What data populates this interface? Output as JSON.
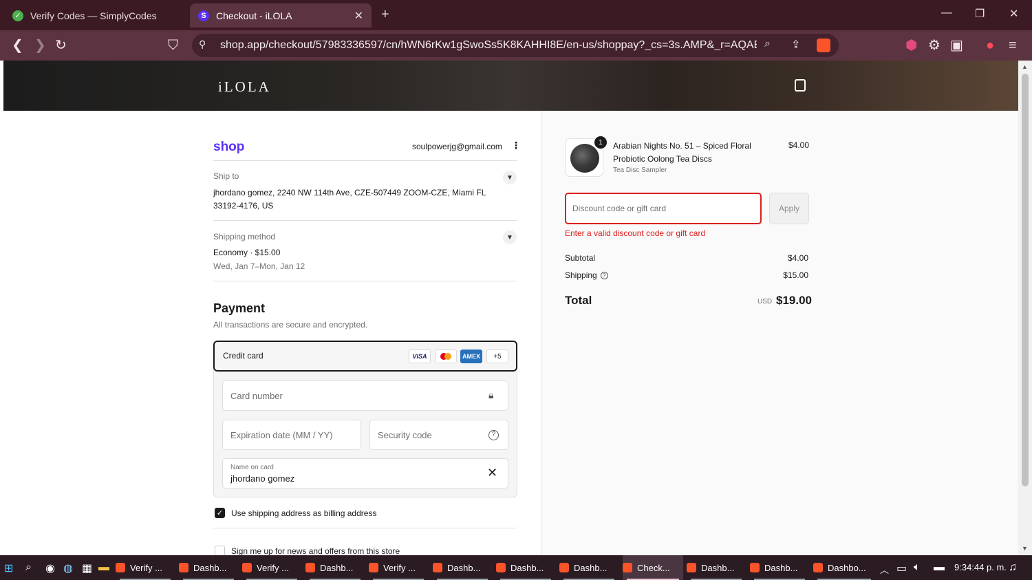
{
  "browser": {
    "tabs": [
      {
        "title": "Verify Codes — SimplyCodes",
        "active": false
      },
      {
        "title": "Checkout - iLOLA",
        "active": true
      }
    ],
    "url": "shop.app/checkout/57983336597/cn/hWN6rKw1gSwoSs5K8KAHHI8E/en-us/shoppay?_cs=3s.AMP&_r=AQABnr_..."
  },
  "store": {
    "logo": "iLOLA"
  },
  "checkout": {
    "shop_logo": "shop",
    "email": "soulpowerjg@gmail.com",
    "ship_to": {
      "label": "Ship to",
      "address_line1": "jhordano gomez, 2240 NW 114th Ave, CZE-507449 ZOOM-CZE, Miami FL",
      "address_line2": "33192-4176, US"
    },
    "shipping_method": {
      "label": "Shipping method",
      "name": "Economy · $15.00",
      "dates": "Wed, Jan 7–Mon, Jan 12"
    },
    "payment": {
      "title": "Payment",
      "subtitle": "All transactions are secure and encrypted.",
      "method_label": "Credit card",
      "card_brands": [
        "VISA",
        "",
        "AMEX",
        "+5"
      ],
      "card_number_placeholder": "Card number",
      "expiration_placeholder": "Expiration date (MM / YY)",
      "security_placeholder": "Security code",
      "name_label": "Name on card",
      "name_value": "jhordano gomez"
    },
    "billing_checkbox": {
      "label": "Use shipping address as billing address",
      "checked": true
    },
    "newsletter_checkbox": {
      "label": "Sign me up for news and offers from this store",
      "checked": false
    }
  },
  "order": {
    "item": {
      "quantity": "1",
      "name": "Arabian Nights No. 51 – Spiced Floral Probiotic Oolong Tea Discs",
      "variant": "Tea Disc Sampler",
      "price": "$4.00"
    },
    "discount": {
      "placeholder": "Discount code or gift card",
      "apply_label": "Apply",
      "error": "Enter a valid discount code or gift card"
    },
    "subtotal_label": "Subtotal",
    "subtotal": "$4.00",
    "shipping_label": "Shipping",
    "shipping": "$15.00",
    "total_label": "Total",
    "currency": "USD",
    "total": "$19.00"
  },
  "taskbar": {
    "apps": [
      {
        "label": "Verify ...",
        "active": false
      },
      {
        "label": "Dashb...",
        "active": false
      },
      {
        "label": "Verify ...",
        "active": false
      },
      {
        "label": "Dashb...",
        "active": false
      },
      {
        "label": "Verify ...",
        "active": false
      },
      {
        "label": "Dashb...",
        "active": false
      },
      {
        "label": "Dashb...",
        "active": false
      },
      {
        "label": "Dashb...",
        "active": false
      },
      {
        "label": "Check...",
        "active": true
      },
      {
        "label": "Dashb...",
        "active": false
      },
      {
        "label": "Dashb...",
        "active": false
      },
      {
        "label": "Dashbo...",
        "active": false
      }
    ],
    "clock": "9:34:44 p. m."
  },
  "colors": {
    "shop_brand": "#5a31f4",
    "error": "#dd1d1d",
    "browser_bg": "#5c3341"
  }
}
